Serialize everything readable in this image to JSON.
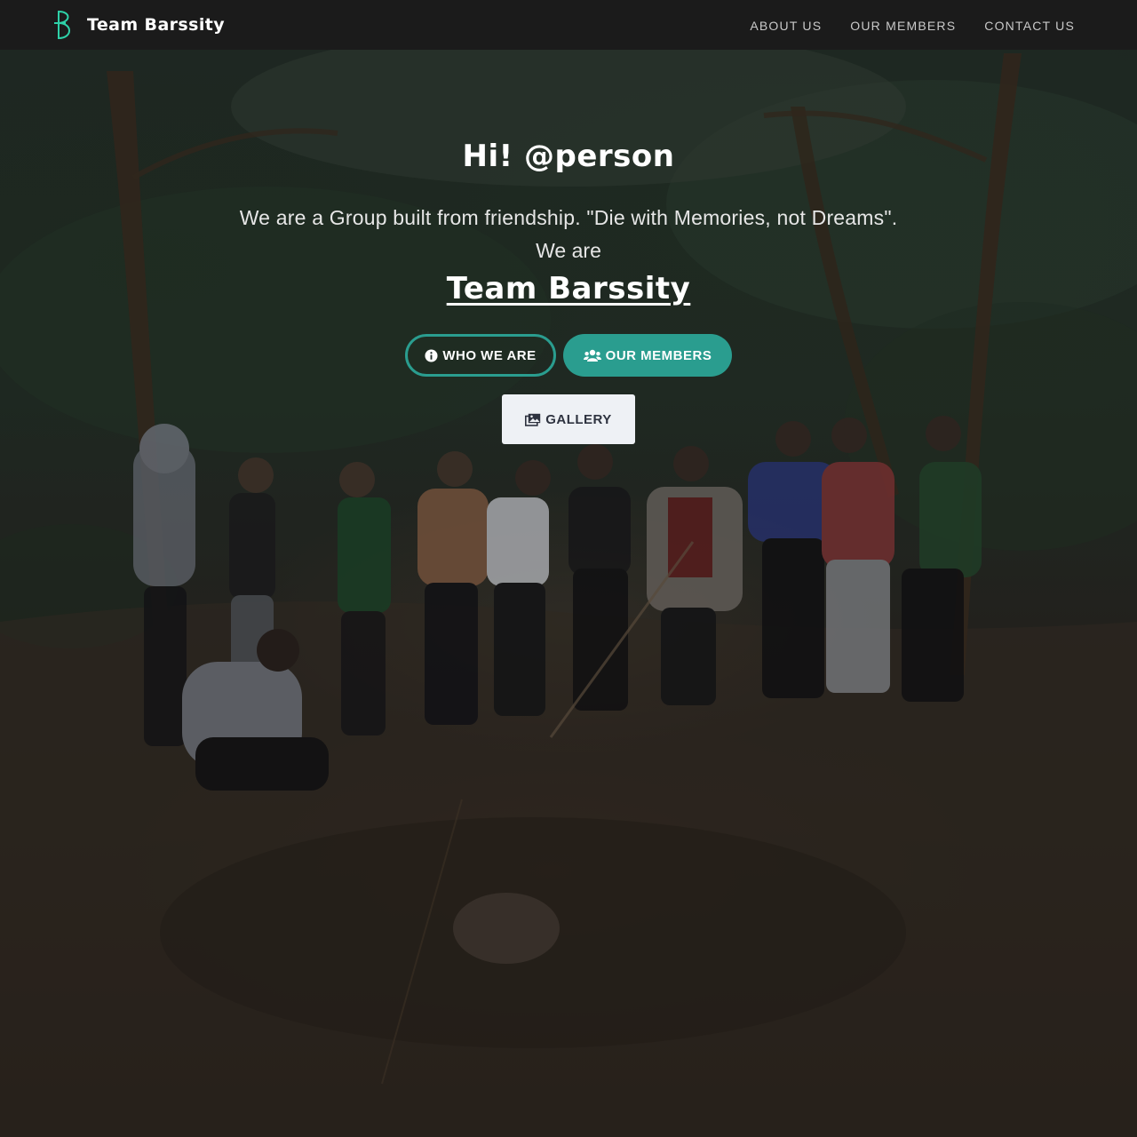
{
  "navbar": {
    "brand": "Team Barssity",
    "brand_logo_icon": "letter-b-logo-icon",
    "links": [
      "ABOUT US",
      "OUR MEMBERS",
      "CONTACT US"
    ]
  },
  "hero": {
    "greeting": "Hi! @person",
    "tagline": "We are a Group built from friendship. \"Die with Memories, not Dreams\".",
    "we_are": "We are",
    "team_name": "Team Barssity",
    "background_image": "group-photo-forest-hilltop"
  },
  "buttons": {
    "who": {
      "label": "WHO WE ARE",
      "icon": "info-circle-icon"
    },
    "members": {
      "label": "OUR MEMBERS",
      "icon": "users-icon"
    },
    "gallery": {
      "label": "GALLERY",
      "icon": "images-icon"
    }
  },
  "colors": {
    "accent": "#2a9d8f",
    "navbar_bg": "#1b1b1b",
    "gallery_button_bg": "#eef1f5"
  }
}
